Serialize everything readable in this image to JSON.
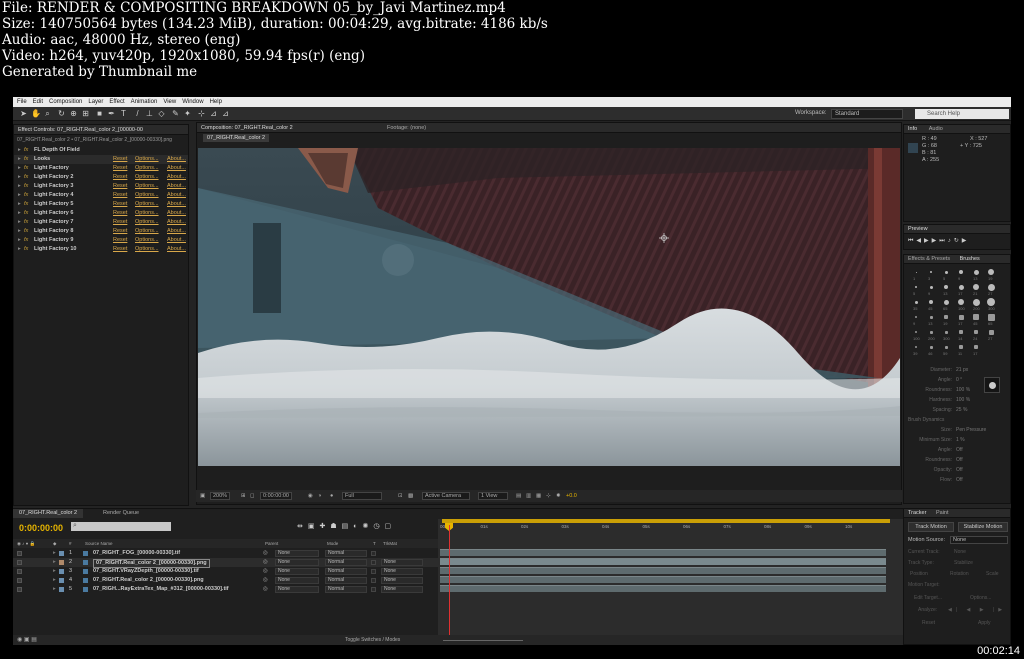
{
  "header": {
    "file": "File: RENDER & COMPOSITING BREAKDOWN 05_by_Javi Martinez.mp4",
    "size": "Size: 140750564 bytes (134.23 MiB), duration: 00:04:29, avg.bitrate: 4186 kb/s",
    "audio": "Audio: aac, 48000 Hz, stereo (eng)",
    "video": "Video: h264, yuv420p, 1920x1080, 59.94 fps(r) (eng)",
    "generated": "Generated by Thumbnail me",
    "timestamp": "00:02:14"
  },
  "menu": [
    "File",
    "Edit",
    "Composition",
    "Layer",
    "Effect",
    "Animation",
    "View",
    "Window",
    "Help"
  ],
  "toolbar": {
    "workspace_label": "Workspace:",
    "workspace_value": "Standard",
    "search_placeholder": "Search Help"
  },
  "effects_panel": {
    "tab": "Effect Controls: 07_RIGHT.Real_color 2_[00000-00",
    "path": "07_RIGHT.Real_color 2 • 07_RIGHT.Real_color 2_[00000-00330].png",
    "reset": "Reset",
    "options": "Options...",
    "about": "About...",
    "effects": [
      {
        "name": "FL Depth Of Field",
        "badge": "fx",
        "controls": false
      },
      {
        "name": "Looks",
        "badge": "fx",
        "controls": true
      },
      {
        "name": "Light Factory",
        "badge": "fx",
        "controls": true
      },
      {
        "name": "Light Factory 2",
        "badge": "fx",
        "controls": true
      },
      {
        "name": "Light Factory 3",
        "badge": "fx",
        "controls": true
      },
      {
        "name": "Light Factory 4",
        "badge": "fx",
        "controls": true
      },
      {
        "name": "Light Factory 5",
        "badge": "fx",
        "controls": true
      },
      {
        "name": "Light Factory 6",
        "badge": "fx",
        "controls": true
      },
      {
        "name": "Light Factory 7",
        "badge": "fx",
        "controls": true
      },
      {
        "name": "Light Factory 8",
        "badge": "fx",
        "controls": true
      },
      {
        "name": "Light Factory 9",
        "badge": "fx",
        "controls": true
      },
      {
        "name": "Light Factory 10",
        "badge": "fx",
        "controls": true
      }
    ]
  },
  "composition": {
    "tab": "Composition: 07_RIGHT.Real_color 2",
    "footage_tab": "Footage: (none)",
    "subtab": "07_RIGHT.Real_color 2",
    "zoom": "200%",
    "time": "0:00:00:00",
    "resolution": "Full",
    "camera": "Active Camera",
    "view": "1 View",
    "exposure": "+0.0"
  },
  "info": {
    "tab_info": "Info",
    "tab_audio": "Audio",
    "r": "R : 49",
    "g": "G : 68",
    "b": "B : 81",
    "a": "A : 255",
    "x": "X : 527",
    "y": "Y : 725"
  },
  "preview": {
    "tab": "Preview"
  },
  "brushes": {
    "tab_effects": "Effects & Presets",
    "tab_brushes": "Brushes",
    "sizes": [
      "1",
      "3",
      "5",
      "9",
      "13",
      "19",
      "5",
      "9",
      "13",
      "17",
      "21",
      "27",
      "35",
      "45",
      "65",
      "100",
      "200",
      "300",
      "9",
      "13",
      "19",
      "17",
      "45",
      "65",
      "100",
      "200",
      "300",
      "14",
      "24",
      "27",
      "39",
      "46",
      "59",
      "11",
      "17"
    ],
    "props": [
      {
        "label": "Diameter:",
        "value": "21 px"
      },
      {
        "label": "Angle:",
        "value": "0 °"
      },
      {
        "label": "Roundness:",
        "value": "100 %"
      },
      {
        "label": "Hardness:",
        "value": "100 %"
      },
      {
        "label": "Spacing:",
        "value": "25 %"
      },
      {
        "label": "Brush Dynamics",
        "value": ""
      },
      {
        "label": "Size:",
        "value": "Pen Pressure"
      },
      {
        "label": "Minimum Size:",
        "value": "1 %"
      },
      {
        "label": "Angle:",
        "value": "Off"
      },
      {
        "label": "Roundness:",
        "value": "Off"
      },
      {
        "label": "Opacity:",
        "value": "Off"
      },
      {
        "label": "Flow:",
        "value": "Off"
      }
    ]
  },
  "tracker": {
    "tab_tracker": "Tracker",
    "tab_paint": "Paint",
    "track_motion": "Track Motion",
    "stabilize": "Stabilize Motion",
    "motion_source_label": "Motion Source:",
    "motion_source": "None",
    "current_track_label": "Current Track:",
    "current_track": "None",
    "track_type_label": "Track Type:",
    "track_type": "Stabilize",
    "position": "Position",
    "rotation": "Rotation",
    "scale": "Scale",
    "motion_target": "Motion Target:",
    "edit_target": "Edit Target...",
    "options": "Options...",
    "analyze": "Analyze:",
    "reset": "Reset",
    "apply": "Apply"
  },
  "timeline": {
    "tab": "07_RIGHT.Real_color 2",
    "render_queue": "Render Queue",
    "time": "0:00:00:00",
    "cols": {
      "source": "Source Name",
      "parent": "Parent",
      "mode": "Mode",
      "t": "T",
      "trkmat": "TrkMat"
    },
    "ticks": [
      "00s",
      "01s",
      "02s",
      "03s",
      "04s",
      "05s",
      "06s",
      "07s",
      "08s",
      "09s",
      "10s"
    ],
    "layers": [
      {
        "num": "1",
        "name": "07_RIGHT_FOG_[00000-00330].tif",
        "parent": "None",
        "mode": "Normal",
        "trk": "",
        "color": "#6a8fb0"
      },
      {
        "num": "2",
        "name": "07_RIGHT.Real_color 2_[00000-00330].png",
        "parent": "None",
        "mode": "Normal",
        "trk": "None",
        "color": "#b08a6a"
      },
      {
        "num": "3",
        "name": "07_RIGHT.VRayZDepth_[00000-00330].tif",
        "parent": "None",
        "mode": "Normal",
        "trk": "None",
        "color": "#6a8fb0"
      },
      {
        "num": "4",
        "name": "07_RIGHT.Real_color 2_[00000-00330].png",
        "parent": "None",
        "mode": "Normal",
        "trk": "None",
        "color": "#6a8fb0"
      },
      {
        "num": "5",
        "name": "07_RIGH...RayExtraTex_Map_#312_[00000-00330].tif",
        "parent": "None",
        "mode": "Normal",
        "trk": "None",
        "color": "#6a8fb0"
      }
    ],
    "toggle": "Toggle Switches / Modes"
  }
}
